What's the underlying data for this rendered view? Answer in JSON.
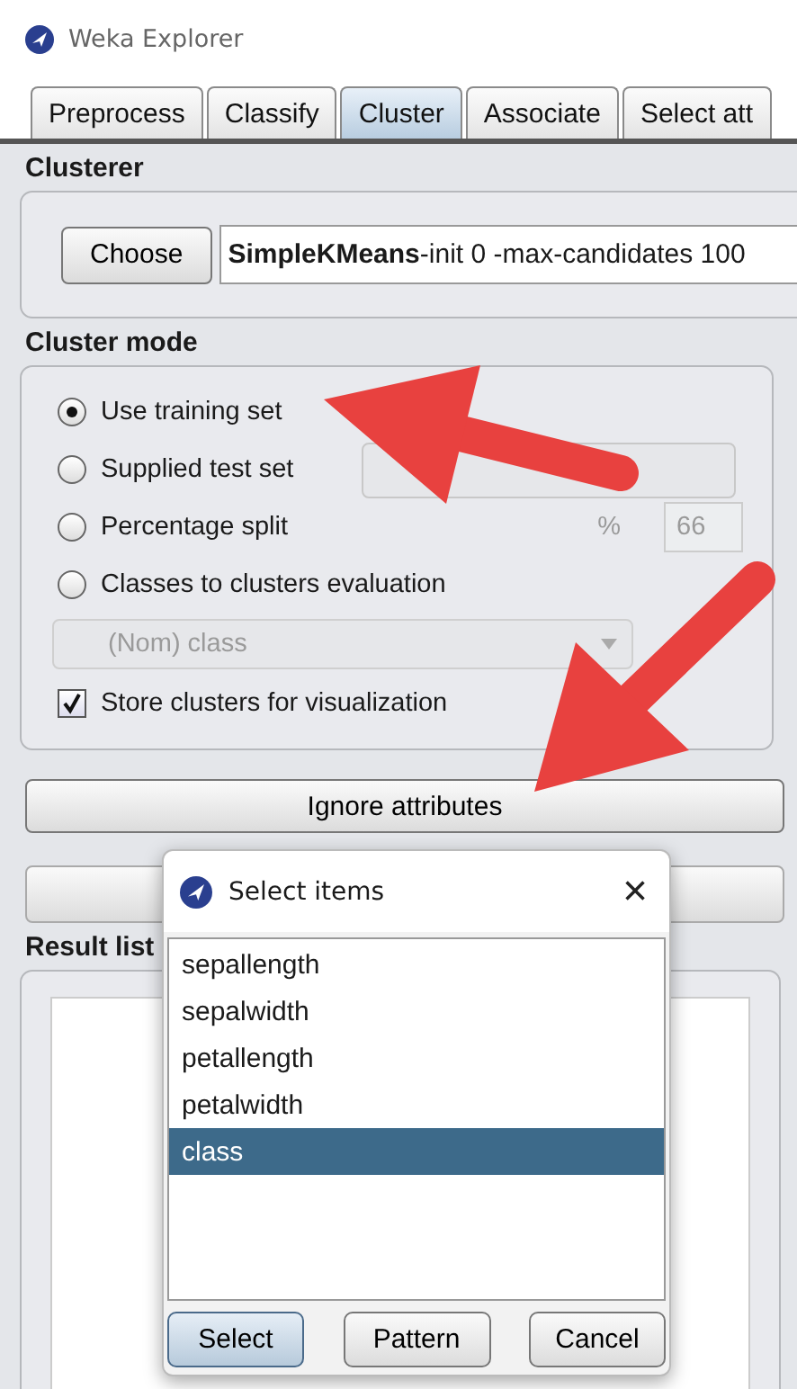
{
  "window": {
    "title": "Weka Explorer"
  },
  "tabs": [
    {
      "label": "Preprocess",
      "selected": false
    },
    {
      "label": "Classify",
      "selected": false
    },
    {
      "label": "Cluster",
      "selected": true
    },
    {
      "label": "Associate",
      "selected": false
    },
    {
      "label": "Select att",
      "selected": false
    }
  ],
  "clusterer": {
    "heading": "Clusterer",
    "choose_button": "Choose",
    "name": "SimpleKMeans",
    "options": "-init 0 -max-candidates 100"
  },
  "cluster_mode": {
    "heading": "Cluster mode",
    "options": [
      {
        "kind": "radio",
        "label": "Use training set",
        "selected": true
      },
      {
        "kind": "radio",
        "label": "Supplied test set",
        "selected": false,
        "control": {
          "kind": "button",
          "disabled": true
        }
      },
      {
        "kind": "radio",
        "label": "Percentage split",
        "selected": false,
        "control": {
          "kind": "percent",
          "symbol": "%",
          "value": "66",
          "disabled": true
        }
      },
      {
        "kind": "radio",
        "label": "Classes to clusters evaluation",
        "selected": false
      },
      {
        "kind": "dropdown",
        "value": "(Nom) class",
        "disabled": true
      },
      {
        "kind": "checkbox",
        "label": "Store clusters for visualization",
        "checked": true
      }
    ]
  },
  "ignore_button": "Ignore attributes",
  "result_list": {
    "heading": "Result list"
  },
  "dialog": {
    "title": "Select items",
    "close": "×",
    "items": [
      {
        "label": "sepallength",
        "selected": false
      },
      {
        "label": "sepalwidth",
        "selected": false
      },
      {
        "label": "petallength",
        "selected": false
      },
      {
        "label": "petalwidth",
        "selected": false
      },
      {
        "label": "class",
        "selected": true
      }
    ],
    "buttons": [
      {
        "label": "Select",
        "default": true
      },
      {
        "label": "Pattern",
        "default": false
      },
      {
        "label": "Cancel",
        "default": false
      }
    ]
  }
}
